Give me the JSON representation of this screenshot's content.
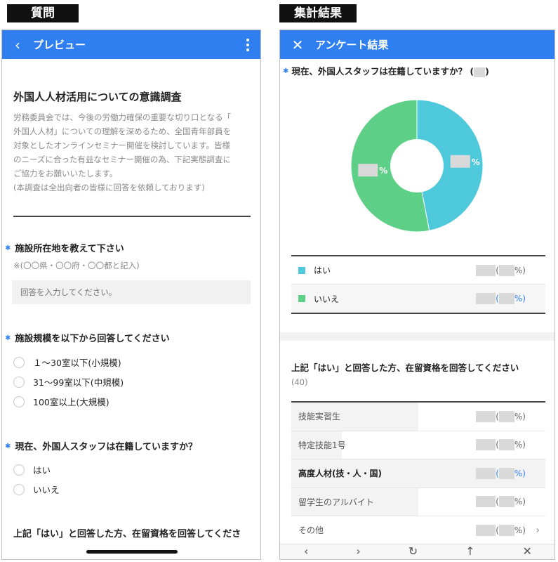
{
  "labels": {
    "left_section": "質問",
    "right_section": "集計結果"
  },
  "preview": {
    "appbar_title": "プレビュー",
    "survey_title": "外国人人材活用についての意識調査",
    "description_lines": [
      "労務委員会では、今後の労働力確保の重要な切り口となる「",
      "外国人人材」についての理解を深めるため、全国青年部員を",
      "対象としたオンラインセミナー開催を検討しています。皆様",
      "のニーズに合った有益なセミナー開催の為、下記実態調査に",
      "ご協力をお願いいたします。",
      "(本調査は全出向者の皆様に回答を依頼しております)"
    ],
    "q1": {
      "label": "施設所在地を教えて下さい",
      "note": "※(〇〇県・〇〇府・〇〇都と記入)",
      "placeholder": "回答を入力してください。"
    },
    "q2": {
      "label": "施設規模を以下から回答してください",
      "options": [
        "１〜30室以下(小規模)",
        "31〜99室以下(中規模)",
        "100室以上(大規模)"
      ]
    },
    "q3": {
      "label": "現在、外国人スタッフは在籍していますか？",
      "options": [
        "はい",
        "いいえ"
      ]
    },
    "q4": {
      "label": "上記「はい」と回答した方、在留資格を回答してくださ"
    }
  },
  "results": {
    "appbar_title": "アンケート結果",
    "question": "現在、外国人スタッフは在籍していますか？ (",
    "question_close": ")",
    "chart_data": {
      "type": "pie",
      "categories": [
        "はい",
        "いいえ"
      ],
      "values": [
        47,
        53
      ],
      "colors": [
        "#4ec9dc",
        "#5ecf86"
      ],
      "label_suffix": "%"
    },
    "legend": [
      {
        "label": "はい",
        "color": "#4ec9dc",
        "open": "(",
        "pct": "%)"
      },
      {
        "label": "いいえ",
        "color": "#5ecf86",
        "open": "(",
        "pct": "%)"
      }
    ],
    "q2_label": "上記「はい」と回答した方、在留資格を回答してください",
    "q2_count": "(40)",
    "rows": [
      {
        "label": "技能実習生",
        "bar": 0.5,
        "open": "(",
        "pct": "%)"
      },
      {
        "label": "特定技能1号",
        "bar": 0.2,
        "open": "(",
        "pct": "%)"
      },
      {
        "label": "高度人材(技・人・国)",
        "bar": 1.0,
        "open": "(",
        "pct": "%)"
      },
      {
        "label": "留学生のアルバイト",
        "bar": 0.5,
        "open": "(",
        "pct": "%)"
      },
      {
        "label": "その他",
        "bar": 0.0,
        "open": "(",
        "pct": "%)"
      }
    ]
  }
}
